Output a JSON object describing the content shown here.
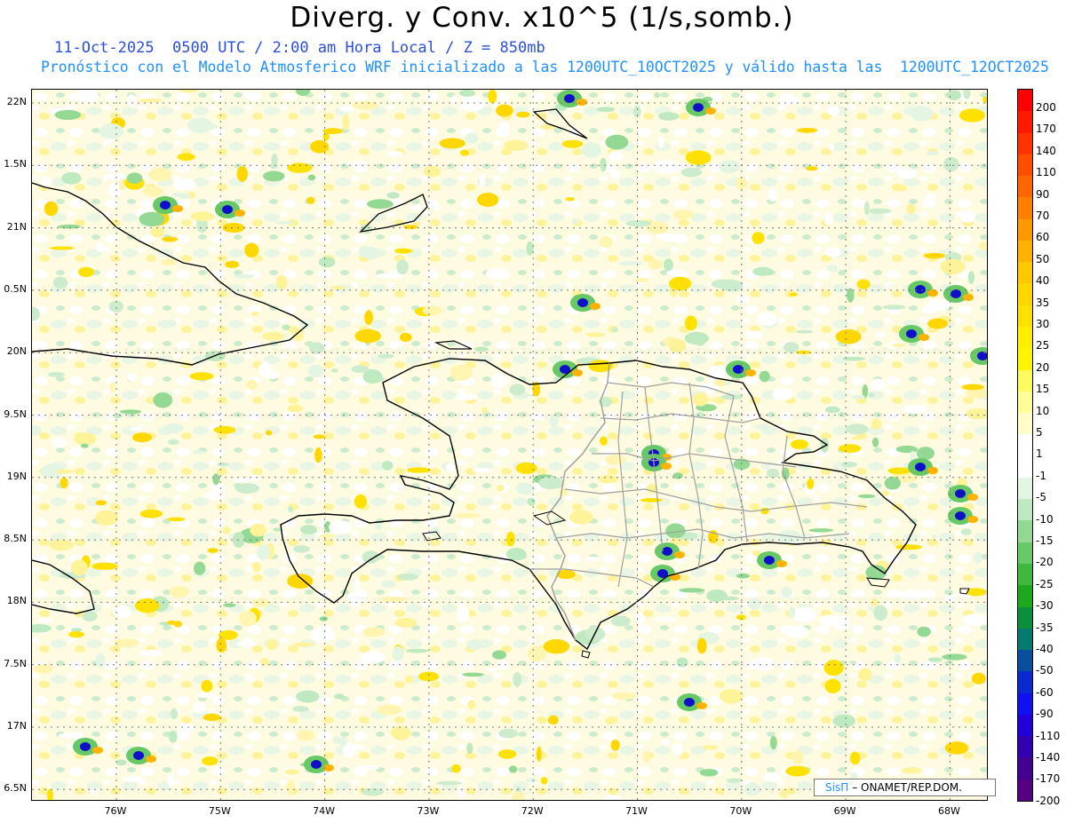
{
  "title": "Diverg. y Conv. x10^5 (1/s,somb.)",
  "subtitle_line1": "11-Oct-2025  0500 UTC / 2:00 am Hora Local / Z = 850mb",
  "subtitle_line2": "Pronóstico con el Modelo Atmosferico WRF inicializado a las 1200UTC_10OCT2025 y válido hasta las  1200UTC_12OCT2025",
  "lat_labels": [
    "22N",
    "1.5N",
    "21N",
    "0.5N",
    "20N",
    "9.5N",
    "19N",
    "8.5N",
    "18N",
    "7.5N",
    "17N",
    "6.5N"
  ],
  "lon_labels": [
    "76W",
    "75W",
    "74W",
    "73W",
    "72W",
    "71W",
    "70W",
    "69W",
    "68W"
  ],
  "colorbar": {
    "labels": [
      "200",
      "170",
      "140",
      "110",
      "90",
      "70",
      "60",
      "50",
      "40",
      "35",
      "30",
      "25",
      "20",
      "15",
      "10",
      "5",
      "1",
      "-1",
      "-5",
      "-10",
      "-15",
      "-20",
      "-25",
      "-30",
      "-35",
      "-40",
      "-50",
      "-60",
      "-90",
      "-110",
      "-140",
      "-170",
      "-200"
    ],
    "colors": [
      "#ff0000",
      "#ff1a00",
      "#ff3300",
      "#ff4d00",
      "#ff6600",
      "#ff8000",
      "#ff9900",
      "#ffb300",
      "#ffc800",
      "#ffd700",
      "#ffe100",
      "#ffee00",
      "#fff500",
      "#fffa60",
      "#fffc9a",
      "#fffdc8",
      "#ffffff",
      "#ffffff",
      "#e4f5e4",
      "#bfe9bf",
      "#93d993",
      "#66c966",
      "#3fb83f",
      "#1ea81e",
      "#0b8f3b",
      "#067a6e",
      "#0a4e9e",
      "#0a2ad0",
      "#1010f0",
      "#2200d8",
      "#3300b0",
      "#440090",
      "#550080"
    ]
  },
  "credit": {
    "brand": "SisΠ",
    "text": "– ONAMET/REP.DOM."
  },
  "colors": {
    "title": "#000000",
    "subtitle1": "#2b4fd8",
    "subtitle2": "#1e90ff",
    "coastline": "#000000",
    "provinces": "#a0a0a0"
  }
}
